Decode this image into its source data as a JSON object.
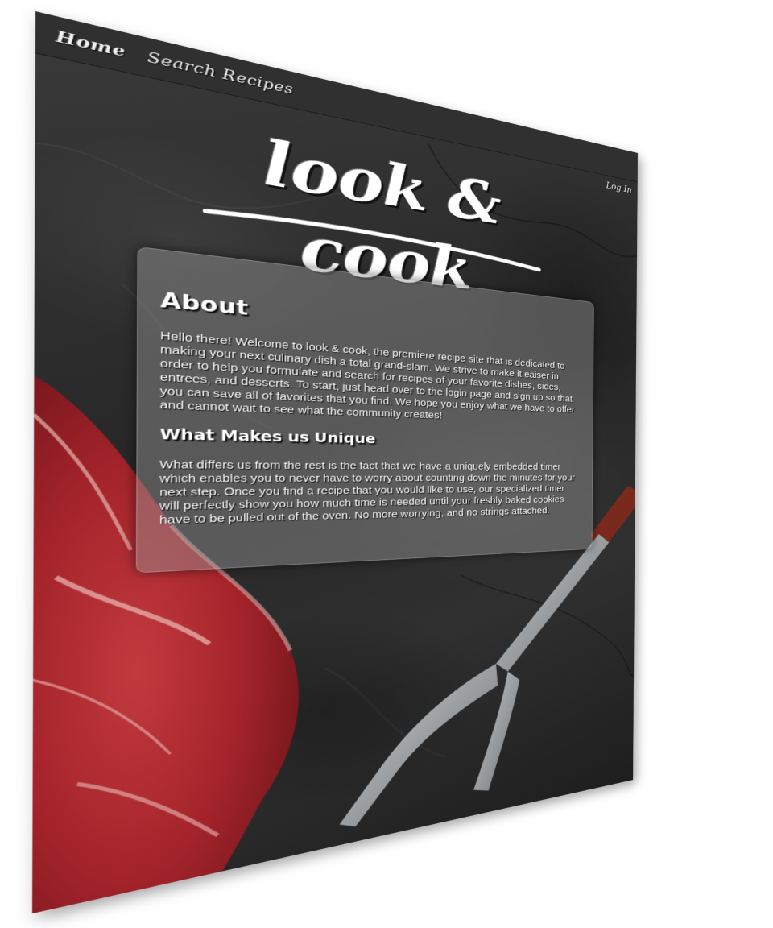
{
  "nav": {
    "home": "Home",
    "search_recipes": "Search Recipes",
    "log_in": "Log In"
  },
  "brand": {
    "logo_text": "look & cook"
  },
  "about": {
    "heading": "About",
    "intro": "Hello there! Welcome to look & cook, the premiere recipe site that is dedicated to making your next culinary dish a total grand-slam. We strive to make it eaiser in order to help you formulate and search for recipes of your favorite dishes, sides, entrees, and desserts. To start, just head over to the login page and sign up so that you can save all of favorites that you find. We hope you enjoy what we have to offer and cannot wait to see what the community creates!",
    "unique_heading": "What Makes us Unique",
    "unique_text": "What differs us from the rest is the fact that we have a uniquely embedded timer which enables you to never have to worry about counting down the minutes for your next step. Once you find a recipe that you would like to use, our specialized timer will perfectly show you how much time is needed until your freshly baked cookies have to be pulled out of the oven. No more worrying, and no strings attached."
  },
  "colors": {
    "nav_background": "#303030",
    "slate_background": "#2a2a2a",
    "panel_background": "#969696",
    "text": "#ffffff",
    "steak_red": "#a8242b",
    "fork_steel": "#a9acae",
    "fork_handle": "#7a2a1c"
  },
  "imagery": {
    "background": "slate-texture",
    "left_image": "raw-steak",
    "right_image": "carving-fork"
  }
}
